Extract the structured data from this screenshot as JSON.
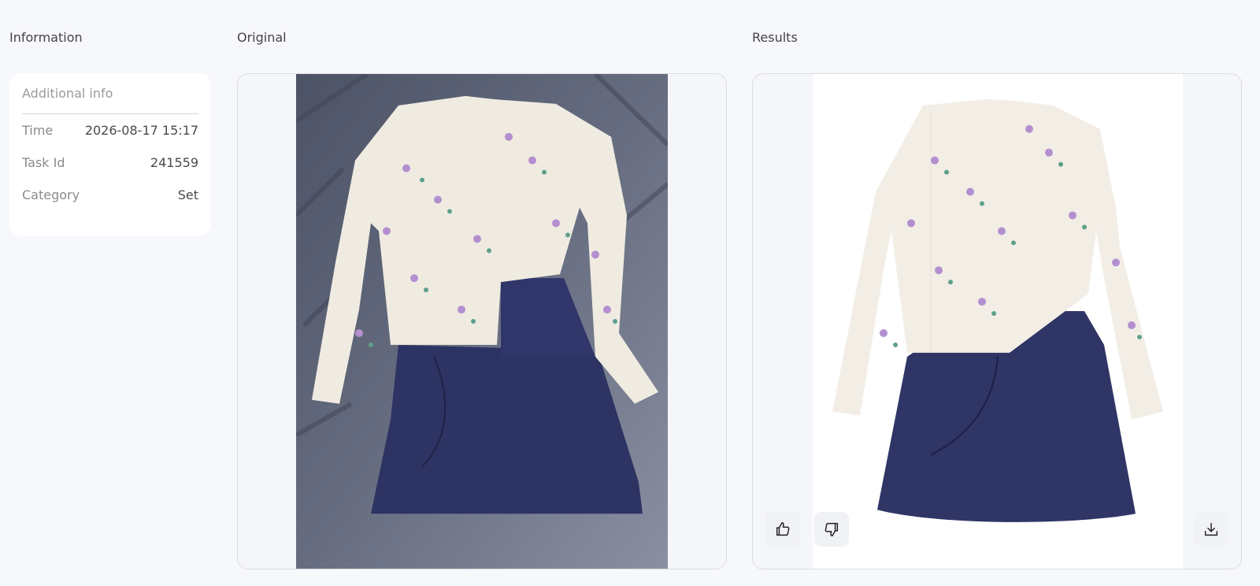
{
  "columns": {
    "information": "Information",
    "original": "Original",
    "results": "Results"
  },
  "info": {
    "header": "Additional info",
    "rows": [
      {
        "key": "Time",
        "value": "2026-08-17 15:17"
      },
      {
        "key": "Task Id",
        "value": "241559"
      },
      {
        "key": "Category",
        "value": "Set"
      }
    ]
  },
  "images": {
    "original": "floral cardigan and navy skirt on gray fabric",
    "result": "floral cardigan and navy skirt on white background"
  },
  "icons": {
    "like": "thumbs-up-icon",
    "dislike": "thumbs-down-icon",
    "download": "download-icon"
  },
  "colors": {
    "background": "#f7f8fc",
    "card": "#ffffff",
    "photo_backdrop": "#5f6577",
    "skirt": "#2f3563",
    "cardigan": "#f2ede4"
  }
}
